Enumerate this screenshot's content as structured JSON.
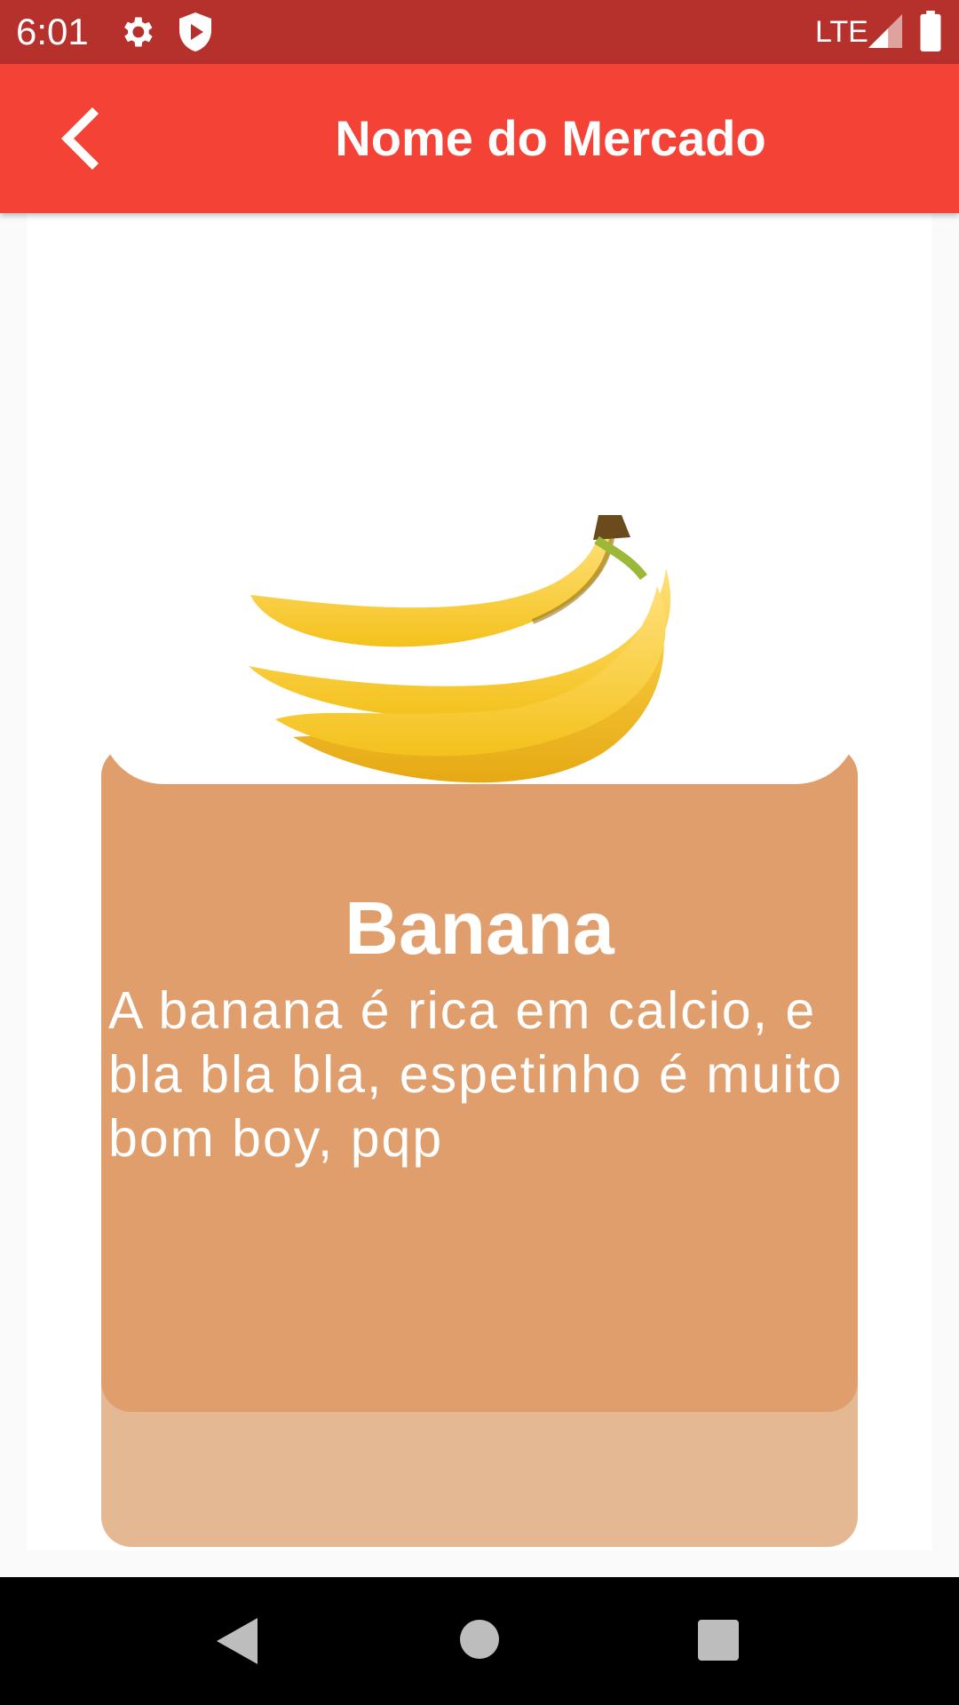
{
  "status_bar": {
    "time": "6:01",
    "network": "LTE",
    "icons": [
      "settings-gear-icon",
      "shield-play-icon",
      "signal-icon",
      "battery-icon"
    ]
  },
  "app_bar": {
    "title": "Nome do Mercado",
    "back_icon": "chevron-left-icon",
    "background_color": "#f44336"
  },
  "product": {
    "name": "Banana",
    "description": "A banana é rica em calcio, e bla bla bla, espetinho é muito bom boy, pqp",
    "card_color": "#df9e6b",
    "card_back_color": "#e5b894"
  },
  "nav_bar": {
    "buttons": [
      "back-triangle-icon",
      "home-circle-icon",
      "recents-square-icon"
    ]
  }
}
